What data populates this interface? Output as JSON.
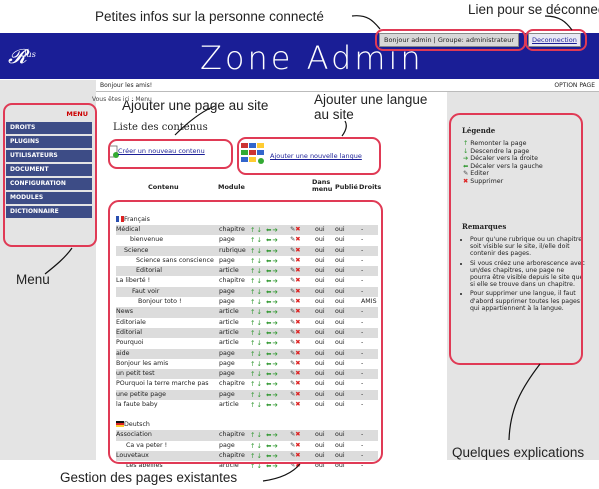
{
  "annotations": {
    "petites_infos": "Petites infos sur la personne connecté",
    "lien_deconnecter": "Lien pour se déconnecter",
    "ajouter_page": "Ajouter une page au site",
    "ajouter_langue": "Ajouter une langue\nau site",
    "menu": "Menu",
    "gestion": "Gestion des pages existantes",
    "explications": "Quelques explications"
  },
  "header": {
    "title": "Zone Admin",
    "user": "Bonjour admin | Groupe: administrateur",
    "logout": "Deconnection"
  },
  "topbar": {
    "greeting": "Bonjour les amis!",
    "option": "OPTION PAGE"
  },
  "breadcrumb": "Vous êtes ici : Menu",
  "menu": {
    "head": "MENU",
    "items": [
      "DROITS",
      "PLUGINS",
      "UTILISATEURS",
      "DOCUMENT",
      "CONFIGURATION",
      "MODULES",
      "DICTIONNAIRE"
    ]
  },
  "content": {
    "heading": "Liste des contenus",
    "add_page": "Créer un nouveau contenu",
    "add_lang": "Ajouter une nouvelle langue",
    "columns": [
      "Contenu",
      "Module",
      "Dans menu",
      "Publié",
      "Droits"
    ],
    "lang_fr": "Français",
    "lang_de": "Deutsch",
    "rows_fr": [
      {
        "name": "Médical",
        "module": "chapitre",
        "menu": "oui",
        "pub": "oui",
        "droits": "-"
      },
      {
        "name": "bienvenue",
        "module": "page",
        "menu": "oui",
        "pub": "oui",
        "droits": "-"
      },
      {
        "name": "Science",
        "module": "rubrique",
        "menu": "oui",
        "pub": "oui",
        "droits": "-"
      },
      {
        "name": "Science sans conscience",
        "module": "page",
        "menu": "oui",
        "pub": "oui",
        "droits": "-"
      },
      {
        "name": "Editorial",
        "module": "article",
        "menu": "oui",
        "pub": "oui",
        "droits": "-"
      },
      {
        "name": "La liberté !",
        "module": "chapitre",
        "menu": "oui",
        "pub": "oui",
        "droits": "-"
      },
      {
        "name": "Faut voir",
        "module": "page",
        "menu": "oui",
        "pub": "oui",
        "droits": "-"
      },
      {
        "name": "Bonjour toto !",
        "module": "page",
        "menu": "oui",
        "pub": "oui",
        "droits": "AMIS"
      },
      {
        "name": "News",
        "module": "article",
        "menu": "oui",
        "pub": "oui",
        "droits": "-"
      },
      {
        "name": "Editoriale",
        "module": "article",
        "menu": "oui",
        "pub": "oui",
        "droits": "-"
      },
      {
        "name": "Editorial",
        "module": "article",
        "menu": "oui",
        "pub": "oui",
        "droits": "-"
      },
      {
        "name": "Pourquoi",
        "module": "article",
        "menu": "oui",
        "pub": "oui",
        "droits": "-"
      },
      {
        "name": "aide",
        "module": "page",
        "menu": "oui",
        "pub": "oui",
        "droits": "-"
      },
      {
        "name": "Bonjour les amis",
        "module": "page",
        "menu": "oui",
        "pub": "oui",
        "droits": "-"
      },
      {
        "name": "un petit test",
        "module": "page",
        "menu": "oui",
        "pub": "oui",
        "droits": "-"
      },
      {
        "name": "POurquoi la terre marche pas",
        "module": "chapitre",
        "menu": "oui",
        "pub": "oui",
        "droits": "-"
      },
      {
        "name": "une petite page",
        "module": "page",
        "menu": "oui",
        "pub": "oui",
        "droits": "-"
      },
      {
        "name": "la faute baby",
        "module": "article",
        "menu": "oui",
        "pub": "oui",
        "droits": "-"
      }
    ],
    "rows_de": [
      {
        "name": "Association",
        "module": "chapitre",
        "menu": "oui",
        "pub": "oui",
        "droits": "-"
      },
      {
        "name": "Ca va peter !",
        "module": "page",
        "menu": "oui",
        "pub": "oui",
        "droits": "-"
      },
      {
        "name": "Louvetaux",
        "module": "chapitre",
        "menu": "oui",
        "pub": "oui",
        "droits": "-"
      },
      {
        "name": "Les abeilles",
        "module": "article",
        "menu": "oui",
        "pub": "oui",
        "droits": "-"
      }
    ]
  },
  "legend": {
    "title": "Légende",
    "items": [
      "Remonter la page",
      "Descendre la page",
      "Décaler vers la droite",
      "Décaler vers la gauche",
      "Editer",
      "Supprimer"
    ]
  },
  "remarks": {
    "title": "Remarques",
    "items": [
      "Pour qu'une rubrique ou un chapitre soit visible sur le site, il/elle doit contenir des pages.",
      "Si vous créez une arborescence avec un/des chapitres, une page ne pourra être visible depuis le site que si elle se trouve dans un chapitre.",
      "Pour supprimer une langue, il faut d'abord supprimer toutes les pages qui appartiennent à la langue."
    ]
  }
}
